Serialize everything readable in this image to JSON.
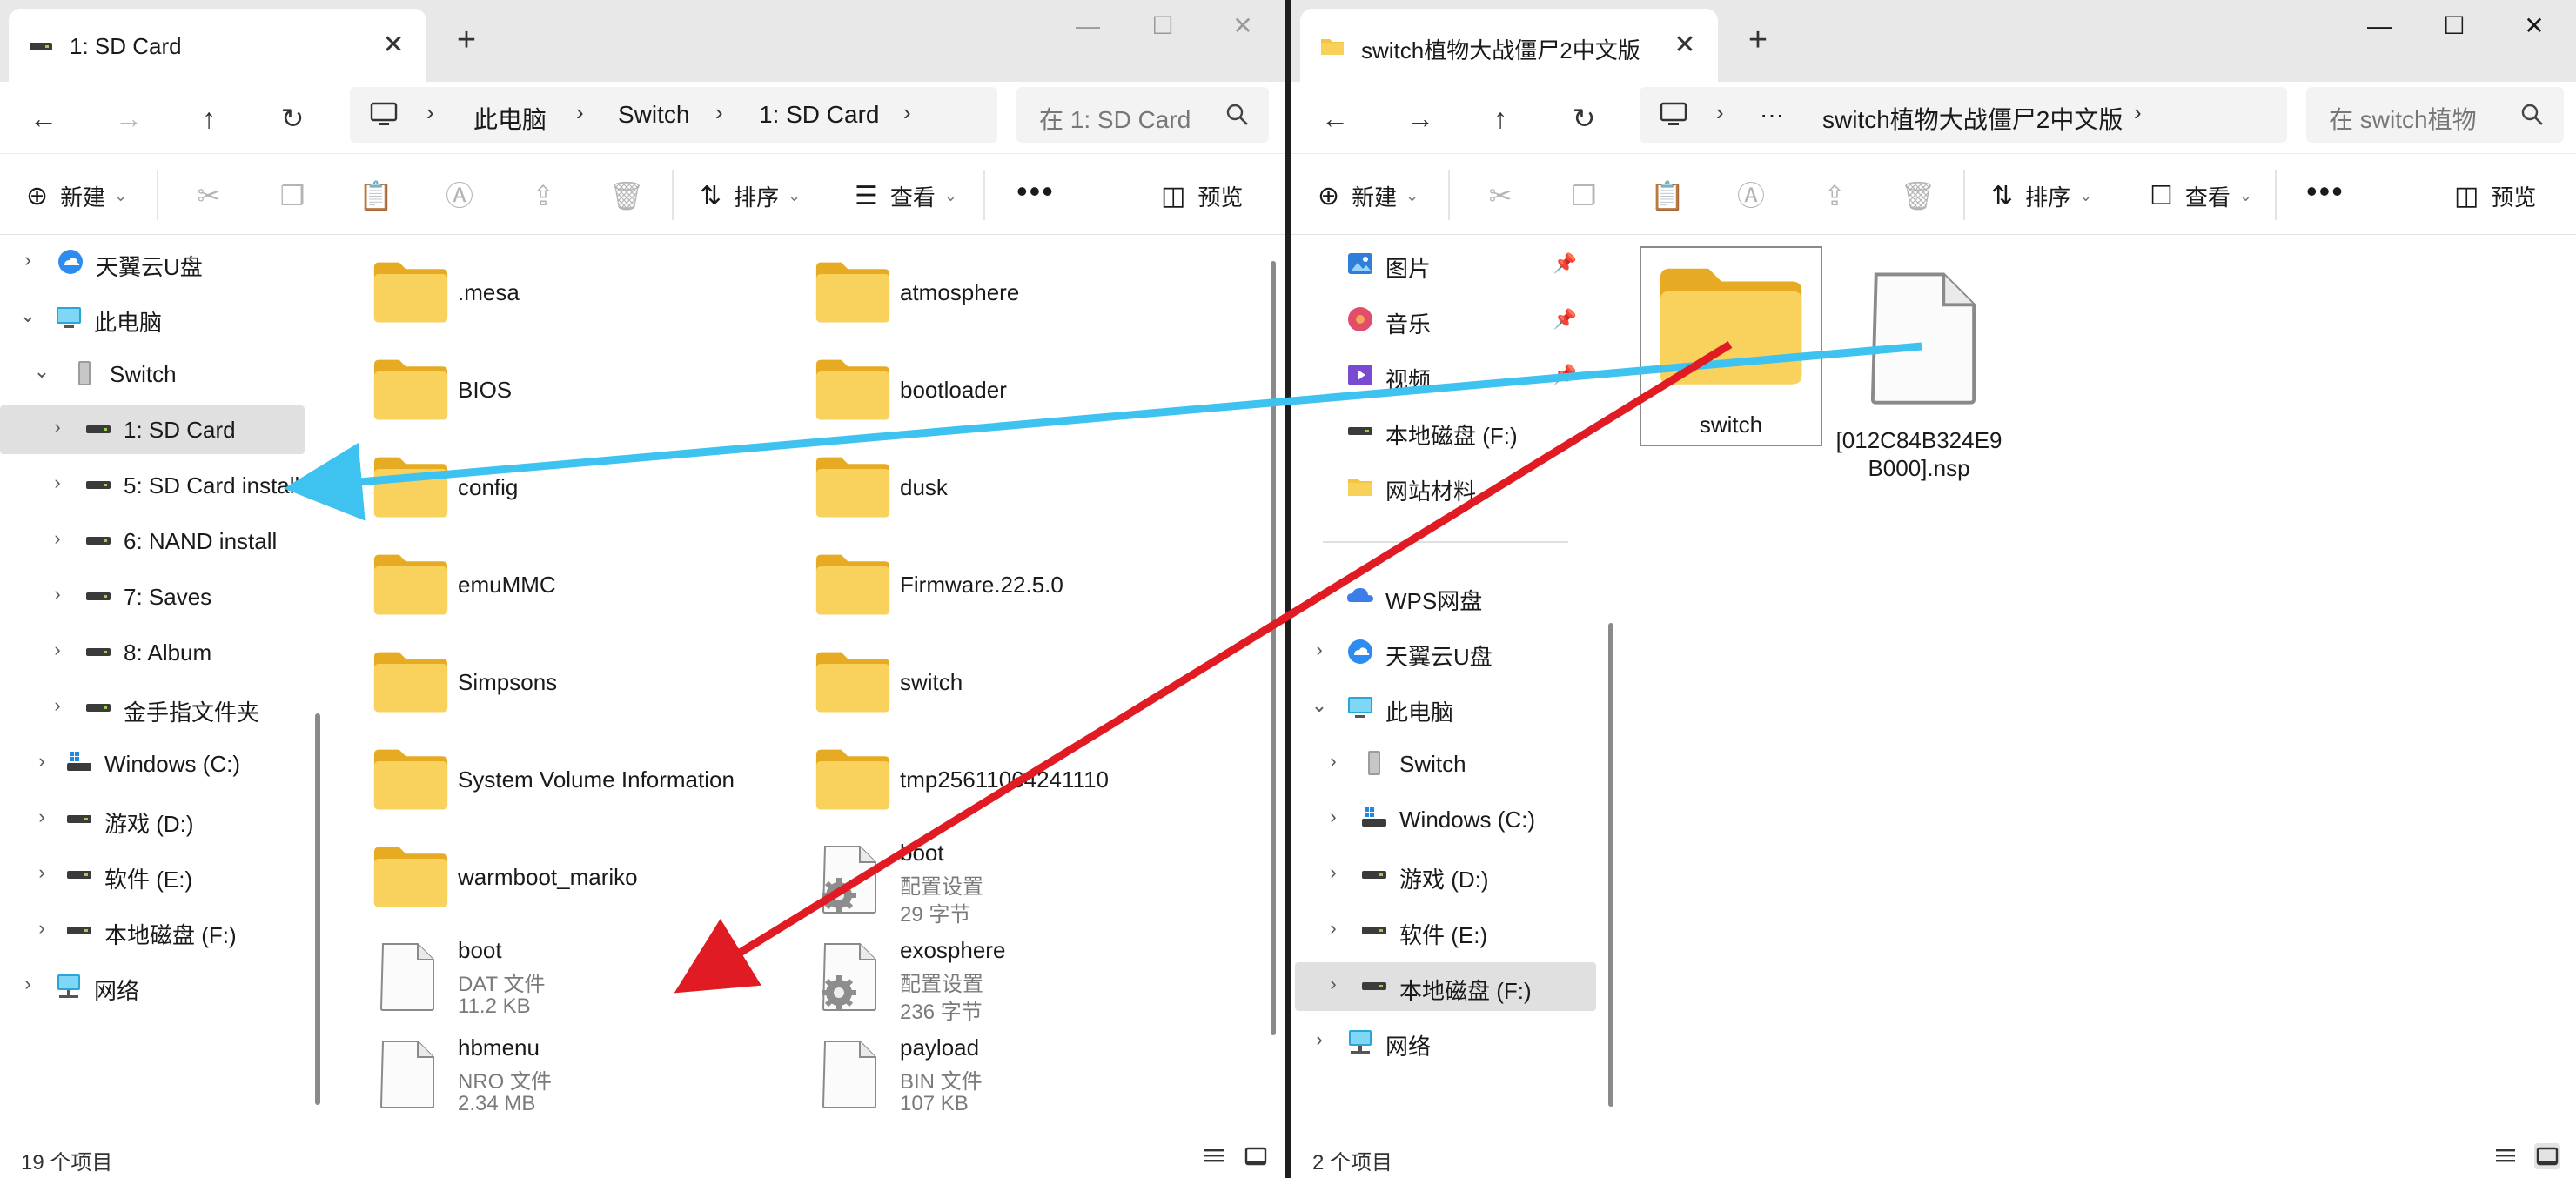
{
  "left": {
    "tab_title": "1: SD Card",
    "breadcrumb": [
      "此电脑",
      "Switch",
      "1: SD Card"
    ],
    "search_placeholder": "在 1: SD Card",
    "toolbar": {
      "new": "新建",
      "sort": "排序",
      "view": "查看",
      "preview": "预览"
    },
    "nav": [
      {
        "label": "天翼云U盘",
        "icon": "cloud-drive-icon"
      },
      {
        "label": "此电脑",
        "icon": "pc-icon"
      },
      {
        "label": "Switch",
        "icon": "device-icon"
      },
      {
        "label": "1: SD Card",
        "icon": "drive-icon"
      },
      {
        "label": "5: SD Card install",
        "icon": "drive-icon"
      },
      {
        "label": "6: NAND install",
        "icon": "drive-icon"
      },
      {
        "label": "7: Saves",
        "icon": "drive-icon"
      },
      {
        "label": "8: Album",
        "icon": "drive-icon"
      },
      {
        "label": "金手指文件夹",
        "icon": "drive-icon"
      },
      {
        "label": "Windows (C:)",
        "icon": "windows-drive-icon"
      },
      {
        "label": "游戏 (D:)",
        "icon": "drive-icon"
      },
      {
        "label": "软件 (E:)",
        "icon": "drive-icon"
      },
      {
        "label": "本地磁盘 (F:)",
        "icon": "drive-icon"
      },
      {
        "label": "网络",
        "icon": "network-icon"
      }
    ],
    "items": [
      {
        "name": ".mesa",
        "type": "folder"
      },
      {
        "name": "atmosphere",
        "type": "folder"
      },
      {
        "name": "BIOS",
        "type": "folder"
      },
      {
        "name": "bootloader",
        "type": "folder"
      },
      {
        "name": "config",
        "type": "folder"
      },
      {
        "name": "dusk",
        "type": "folder"
      },
      {
        "name": "emuMMC",
        "type": "folder"
      },
      {
        "name": "Firmware.22.5.0",
        "type": "folder"
      },
      {
        "name": "Simpsons",
        "type": "folder"
      },
      {
        "name": "switch",
        "type": "folder"
      },
      {
        "name": "System Volume Information",
        "type": "folder"
      },
      {
        "name": "tmp25611064241110",
        "type": "folder"
      },
      {
        "name": "warmboot_mariko",
        "type": "folder"
      },
      {
        "name": "boot",
        "type": "settings",
        "kind": "配置设置",
        "size": "29 字节"
      },
      {
        "name": "boot",
        "type": "file",
        "kind": "DAT 文件",
        "size": "11.2 KB"
      },
      {
        "name": "exosphere",
        "type": "settings",
        "kind": "配置设置",
        "size": "236 字节"
      },
      {
        "name": "hbmenu",
        "type": "file",
        "kind": "NRO 文件",
        "size": "2.34 MB"
      },
      {
        "name": "payload",
        "type": "file",
        "kind": "BIN 文件",
        "size": "107 KB"
      }
    ],
    "status": "19 个项目"
  },
  "right": {
    "tab_title": "switch植物大战僵尸2中文版",
    "breadcrumb": [
      "···",
      "switch植物大战僵尸2中文版"
    ],
    "search_placeholder": "在 switch植物",
    "toolbar": {
      "new": "新建",
      "sort": "排序",
      "view": "查看",
      "preview": "预览"
    },
    "nav": [
      {
        "label": "图片",
        "icon": "pictures-icon",
        "pinned": true
      },
      {
        "label": "音乐",
        "icon": "music-icon",
        "pinned": true
      },
      {
        "label": "视频",
        "icon": "video-icon",
        "pinned": true
      },
      {
        "label": "本地磁盘 (F:)",
        "icon": "drive-icon"
      },
      {
        "label": "网站材料",
        "icon": "folder-icon"
      },
      {
        "label": "WPS网盘",
        "icon": "wps-cloud-icon"
      },
      {
        "label": "天翼云U盘",
        "icon": "cloud-drive-icon"
      },
      {
        "label": "此电脑",
        "icon": "pc-icon"
      },
      {
        "label": "Switch",
        "icon": "device-icon"
      },
      {
        "label": "Windows (C:)",
        "icon": "windows-drive-icon"
      },
      {
        "label": "游戏 (D:)",
        "icon": "drive-icon"
      },
      {
        "label": "软件 (E:)",
        "icon": "drive-icon"
      },
      {
        "label": "本地磁盘 (F:)",
        "icon": "drive-icon"
      },
      {
        "label": "网络",
        "icon": "network-icon"
      }
    ],
    "items": [
      {
        "name": "switch",
        "type": "folder"
      },
      {
        "name": "[012C84B324E9B000].nsp",
        "name_line1": "[012C84B324E9",
        "name_line2": "B000].nsp",
        "type": "file"
      }
    ],
    "status": "2 个项目"
  },
  "colors": {
    "folder": "#f5c542",
    "arrow_blue": "#3ec3f0",
    "arrow_red": "#e01b24",
    "selection": "#e0e0e0"
  }
}
